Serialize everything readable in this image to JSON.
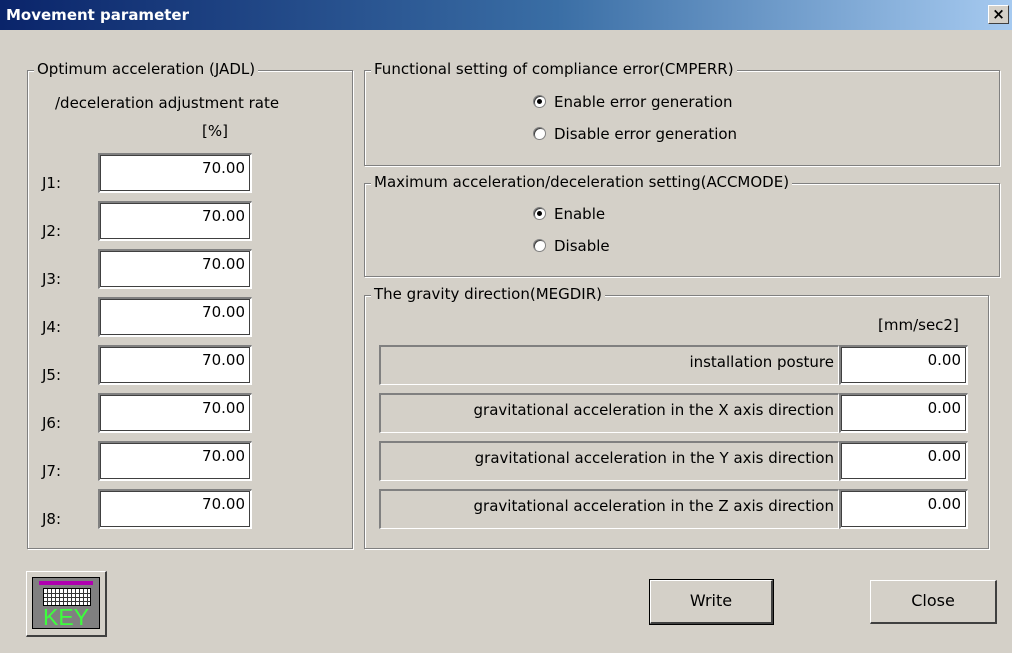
{
  "window": {
    "title": "Movement parameter",
    "close_glyph": "×"
  },
  "jadl": {
    "legend": "Optimum acceleration (JADL)",
    "subtitle": "/deceleration adjustment rate",
    "unit": "[%]",
    "rows": [
      {
        "label": "J1:",
        "value": "70.00"
      },
      {
        "label": "J2:",
        "value": "70.00"
      },
      {
        "label": "J3:",
        "value": "70.00"
      },
      {
        "label": "J4:",
        "value": "70.00"
      },
      {
        "label": "J5:",
        "value": "70.00"
      },
      {
        "label": "J6:",
        "value": "70.00"
      },
      {
        "label": "J7:",
        "value": "70.00"
      },
      {
        "label": "J8:",
        "value": "70.00"
      }
    ]
  },
  "cmperr": {
    "legend": "Functional setting of compliance error(CMPERR)",
    "options": [
      {
        "label": "Enable error generation",
        "checked": true
      },
      {
        "label": "Disable error generation",
        "checked": false
      }
    ]
  },
  "accmode": {
    "legend": "Maximum acceleration/deceleration setting(ACCMODE)",
    "options": [
      {
        "label": "Enable",
        "checked": true
      },
      {
        "label": "Disable",
        "checked": false
      }
    ]
  },
  "megdir": {
    "legend": "The gravity direction(MEGDIR)",
    "unit": "[mm/sec2]",
    "rows": [
      {
        "label": "installation posture",
        "value": "0.00"
      },
      {
        "label": "gravitational acceleration in the X axis direction",
        "value": "0.00"
      },
      {
        "label": "gravitational acceleration in the Y axis direction",
        "value": "0.00"
      },
      {
        "label": "gravitational acceleration in the Z axis direction",
        "value": "0.00"
      }
    ]
  },
  "buttons": {
    "write": "Write",
    "close": "Close",
    "key": "KEY"
  }
}
